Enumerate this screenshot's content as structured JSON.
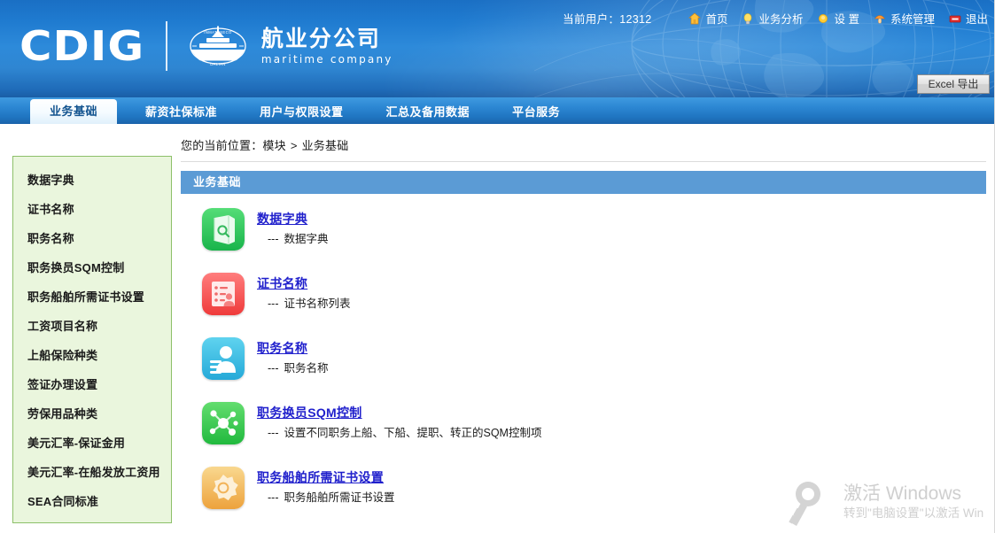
{
  "header": {
    "brand_abbr": "CDIG",
    "brand_cn": "航业分公司",
    "brand_en": "maritime  company",
    "seal_text_top": "INMATESECO",
    "seal_text_bottom": "DALIAN",
    "current_user_label": "当前用户：",
    "current_user_value": "12312",
    "links": [
      {
        "label": "首页",
        "icon": "home-icon",
        "color": "#ffc13b"
      },
      {
        "label": "业务分析",
        "icon": "lightbulb-icon",
        "color": "#ffe066"
      },
      {
        "label": "设 置",
        "icon": "sun-icon",
        "color": "#ffcc33"
      },
      {
        "label": "系统管理",
        "icon": "mushroom-icon",
        "color": "#ff9933"
      },
      {
        "label": "退出",
        "icon": "exit-icon",
        "color": "#e03030"
      }
    ],
    "excel_export": "Excel 导出"
  },
  "tabs": [
    {
      "label": "业务基础",
      "active": true
    },
    {
      "label": "薪资社保标准",
      "active": false
    },
    {
      "label": "用户与权限设置",
      "active": false
    },
    {
      "label": "汇总及备用数据",
      "active": false
    },
    {
      "label": "平台服务",
      "active": false
    }
  ],
  "sidebar": {
    "items": [
      {
        "label": "数据字典"
      },
      {
        "label": "证书名称"
      },
      {
        "label": "职务名称"
      },
      {
        "label": "职务换员SQM控制"
      },
      {
        "label": "职务船舶所需证书设置"
      },
      {
        "label": "工资项目名称"
      },
      {
        "label": "上船保险种类"
      },
      {
        "label": "签证办理设置"
      },
      {
        "label": "劳保用品种类"
      },
      {
        "label": "美元汇率-保证金用"
      },
      {
        "label": "美元汇率-在船发放工资用"
      },
      {
        "label": "SEA合同标准"
      }
    ]
  },
  "breadcrumb": {
    "prefix": "您的当前位置：",
    "root": "模块",
    "separator": ">",
    "current": "业务基础"
  },
  "panel": {
    "title": "业务基础",
    "items": [
      {
        "title": "数据字典",
        "dashes": "---",
        "desc": "数据字典",
        "icon": "book-search-icon",
        "color_from": "#55dd77",
        "color_to": "#19b44b"
      },
      {
        "title": "证书名称",
        "dashes": "---",
        "desc": "证书名称列表",
        "icon": "certificate-list-icon",
        "color_from": "#ff7d7d",
        "color_to": "#ef3b3b"
      },
      {
        "title": "职务名称",
        "dashes": "---",
        "desc": "职务名称",
        "icon": "person-card-icon",
        "color_from": "#5fd3ef",
        "color_to": "#25a9d8"
      },
      {
        "title": "职务换员SQM控制",
        "dashes": "---",
        "desc": "设置不同职务上船、下船、提职、转正的SQM控制项",
        "icon": "network-nodes-icon",
        "color_from": "#63dd6f",
        "color_to": "#21b93e"
      },
      {
        "title": "职务船舶所需证书设置",
        "dashes": "---",
        "desc": "职务船舶所需证书设置",
        "icon": "gear-icon",
        "color_from": "#f7cf7a",
        "color_to": "#eda23c"
      }
    ]
  },
  "watermark": {
    "title": "激活 Windows",
    "subtitle": "转到\"电脑设置\"以激活 Win",
    "icon": "key-magnifier-icon"
  },
  "colors": {
    "header_blue": "#2d8ada",
    "tab_active_text": "#12538f",
    "panel_head_blue": "#5b9bd5",
    "sidebar_bg": "#eaf6dd",
    "sidebar_border": "#8dc06a",
    "link_blue": "#2020cc"
  }
}
